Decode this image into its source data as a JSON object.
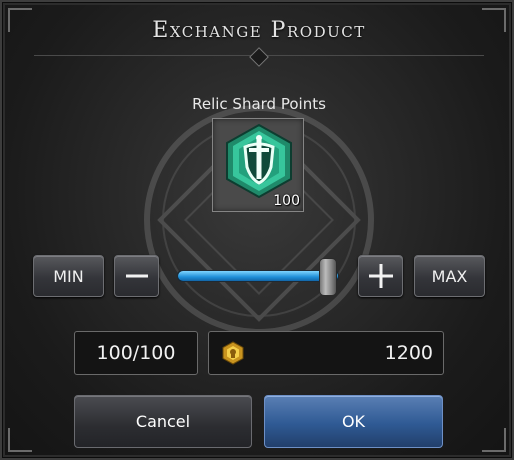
{
  "dialog": {
    "title": "Exchange Product"
  },
  "product": {
    "name": "Relic Shard Points",
    "icon": "shield-sword-emblem-icon",
    "quantity": "100"
  },
  "quantity_controls": {
    "min_label": "MIN",
    "max_label": "MAX",
    "decrement_icon": "minus-icon",
    "increment_icon": "plus-icon",
    "slider_fraction": 1.0
  },
  "summary": {
    "count": "100/100",
    "cost_icon": "gold-token-icon",
    "cost_value": "1200"
  },
  "actions": {
    "cancel_label": "Cancel",
    "ok_label": "OK"
  },
  "colors": {
    "slider_fill": "#1f8fd8",
    "ok_button": "#2f5a94",
    "item_gem": "#2fae8c"
  }
}
